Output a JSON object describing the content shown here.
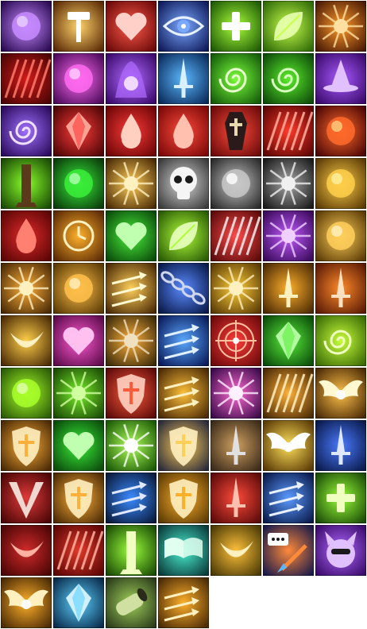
{
  "sheet": {
    "columns": 7,
    "icons": [
      {
        "name": "purple-orb-icon",
        "bg": "#2a0a52",
        "glow": "#c78bff",
        "fg": "#e9d2ff",
        "shape": "orb"
      },
      {
        "name": "hammer-burst-icon",
        "bg": "#5a2a05",
        "glow": "#ffd36b",
        "fg": "#ffffff",
        "shape": "hammer"
      },
      {
        "name": "heart-arrow-icon",
        "bg": "#6a0808",
        "glow": "#ff5a4a",
        "fg": "#ffd0c8",
        "shape": "heart"
      },
      {
        "name": "eye-icon",
        "bg": "#0f1a5a",
        "glow": "#7aa8ff",
        "fg": "#e6f0ff",
        "shape": "eye"
      },
      {
        "name": "green-cross-icon",
        "bg": "#1f5a05",
        "glow": "#a8ff3a",
        "fg": "#ffffff",
        "shape": "cross"
      },
      {
        "name": "leaf-icon",
        "bg": "#2f6a08",
        "glow": "#c8ff4a",
        "fg": "#e8ffb0",
        "shape": "leaf"
      },
      {
        "name": "fire-blade-icon",
        "bg": "#4a1a05",
        "glow": "#ff9a2a",
        "fg": "#ffe0a0",
        "shape": "burst"
      },
      {
        "name": "blood-rain-icon",
        "bg": "#4a0505",
        "glow": "#d01a1a",
        "fg": "#ff7a6a",
        "shape": "streaks"
      },
      {
        "name": "pink-sphere-icon",
        "bg": "#4a0a5a",
        "glow": "#ff6af0",
        "fg": "#ffd0ff",
        "shape": "orb"
      },
      {
        "name": "purple-aura-icon",
        "bg": "#3a0a6a",
        "glow": "#b06aff",
        "fg": "#f0d8ff",
        "shape": "aura"
      },
      {
        "name": "dagger-wings-icon",
        "bg": "#0a2a5a",
        "glow": "#5ab8ff",
        "fg": "#d8f0ff",
        "shape": "sword"
      },
      {
        "name": "green-swirl-icon",
        "bg": "#145a0a",
        "glow": "#7aff3a",
        "fg": "#e8ffd0",
        "shape": "swirl"
      },
      {
        "name": "green-vortex-icon",
        "bg": "#0e4a0a",
        "glow": "#5aef2a",
        "fg": "#d8ffc0",
        "shape": "swirl"
      },
      {
        "name": "wizard-hat-icon",
        "bg": "#3a0a6a",
        "glow": "#a85aff",
        "fg": "#e0c0ff",
        "shape": "hat"
      },
      {
        "name": "purple-galaxy-icon",
        "bg": "#2a0a5a",
        "glow": "#a070ff",
        "fg": "#f0e0ff",
        "shape": "swirl"
      },
      {
        "name": "crimson-crystal-icon",
        "bg": "#4a0505",
        "glow": "#ff3a3a",
        "fg": "#ffb0a0",
        "shape": "gem"
      },
      {
        "name": "blood-drop-orb-icon",
        "bg": "#6a0505",
        "glow": "#ff3a3a",
        "fg": "#ffd0c0",
        "shape": "drop"
      },
      {
        "name": "blood-drop-icon",
        "bg": "#7a0808",
        "glow": "#ff4a3a",
        "fg": "#ffc0b0",
        "shape": "drop"
      },
      {
        "name": "coffin-icon",
        "bg": "#6a0a0a",
        "glow": "#ff4a3a",
        "fg": "#e8d8b0",
        "shape": "coffin"
      },
      {
        "name": "red-slash-icon",
        "bg": "#5a0505",
        "glow": "#ff3a2a",
        "fg": "#ffb0a0",
        "shape": "streaks"
      },
      {
        "name": "fire-rune-icon",
        "bg": "#4a0505",
        "glow": "#ff6a2a",
        "fg": "#ffd080",
        "shape": "orb"
      },
      {
        "name": "green-pillar-icon",
        "bg": "#1a4a05",
        "glow": "#8aff2a",
        "fg": "#5a3a1a",
        "shape": "pillar"
      },
      {
        "name": "poison-cloud-icon",
        "bg": "#0a3a0a",
        "glow": "#3aef3a",
        "fg": "#b0ffb0",
        "shape": "orb"
      },
      {
        "name": "golden-leap-icon",
        "bg": "#4a2a05",
        "glow": "#ffcf5a",
        "fg": "#fff0c0",
        "shape": "burst"
      },
      {
        "name": "skull-icon",
        "bg": "#3a3a3a",
        "glow": "#d8d8d8",
        "fg": "#f5f5f5",
        "shape": "skull"
      },
      {
        "name": "silver-orb-icon",
        "bg": "#2a2a2a",
        "glow": "#c8c8c8",
        "fg": "#ffffff",
        "shape": "orb"
      },
      {
        "name": "steel-gauntlet-icon",
        "bg": "#1a1a1a",
        "glow": "#a8a8a8",
        "fg": "#f0f0f0",
        "shape": "burst"
      },
      {
        "name": "golden-egg-icon",
        "bg": "#5a3a05",
        "glow": "#ffcf4a",
        "fg": "#fff0a0",
        "shape": "orb"
      },
      {
        "name": "blood-drops-icon",
        "bg": "#5a0505",
        "glow": "#e02a2a",
        "fg": "#ff8070",
        "shape": "drop"
      },
      {
        "name": "golden-clock-icon",
        "bg": "#5a2a05",
        "glow": "#ffb02a",
        "fg": "#fff0c0",
        "shape": "clock"
      },
      {
        "name": "green-heart-icon",
        "bg": "#0a4a0a",
        "glow": "#4aef3a",
        "fg": "#c0ffb0",
        "shape": "heart"
      },
      {
        "name": "green-shield-icon",
        "bg": "#2a5a05",
        "glow": "#b0ff3a",
        "fg": "#e8ffc0",
        "shape": "leaf"
      },
      {
        "name": "red-claws-icon",
        "bg": "#5a0a0a",
        "glow": "#ff4a4a",
        "fg": "#f0f0f0",
        "shape": "streaks"
      },
      {
        "name": "purple-claw-icon",
        "bg": "#3a0a5a",
        "glow": "#c05aff",
        "fg": "#f0d0ff",
        "shape": "burst"
      },
      {
        "name": "golden-hand-icon",
        "bg": "#5a3a05",
        "glow": "#ffcf5a",
        "fg": "#fff0c0",
        "shape": "orb"
      },
      {
        "name": "golden-flame-hand-icon",
        "bg": "#4a2a05",
        "glow": "#ffb03a",
        "fg": "#fff0c0",
        "shape": "burst"
      },
      {
        "name": "golden-palm-icon",
        "bg": "#5a3a05",
        "glow": "#ffc04a",
        "fg": "#fff0c0",
        "shape": "orb"
      },
      {
        "name": "golden-arrows-icon",
        "bg": "#4a2a05",
        "glow": "#ffcf5a",
        "fg": "#fff8d0",
        "shape": "arrows"
      },
      {
        "name": "chains-icon",
        "bg": "#0a1a4a",
        "glow": "#5a8aff",
        "fg": "#d0d8f0",
        "shape": "chain"
      },
      {
        "name": "praying-hands-icon",
        "bg": "#5a3a05",
        "glow": "#ffcf3a",
        "fg": "#fff0c0",
        "shape": "burst"
      },
      {
        "name": "holy-sword-icon",
        "bg": "#4a2a05",
        "glow": "#ffb02a",
        "fg": "#fff0c0",
        "shape": "sword"
      },
      {
        "name": "crimson-dagger-icon",
        "bg": "#5a1a05",
        "glow": "#ff8a2a",
        "fg": "#ffe0c0",
        "shape": "sword"
      },
      {
        "name": "golden-crescent-icon",
        "bg": "#4a2a05",
        "glow": "#ffcf4a",
        "fg": "#fff0c0",
        "shape": "crescent"
      },
      {
        "name": "pink-hearts-icon",
        "bg": "#5a0a4a",
        "glow": "#ff5ad0",
        "fg": "#ffc0f0",
        "shape": "heart"
      },
      {
        "name": "golden-boot-icon",
        "bg": "#3a2a0a",
        "glow": "#ffb03a",
        "fg": "#f0e0c0",
        "shape": "burst"
      },
      {
        "name": "blue-spear-icon",
        "bg": "#0a1a5a",
        "glow": "#5aa8ff",
        "fg": "#e0f0ff",
        "shape": "arrows"
      },
      {
        "name": "red-target-icon",
        "bg": "#6a0a0a",
        "glow": "#ff3a3a",
        "fg": "#ffc0a0",
        "shape": "target"
      },
      {
        "name": "green-crystal-icon",
        "bg": "#0a4a0a",
        "glow": "#5aef3a",
        "fg": "#c0ffb0",
        "shape": "gem"
      },
      {
        "name": "lime-wind-icon",
        "bg": "#3a6a05",
        "glow": "#c8ff3a",
        "fg": "#f0ffc0",
        "shape": "swirl"
      },
      {
        "name": "green-egg-icon",
        "bg": "#2a5a05",
        "glow": "#a8ff2a",
        "fg": "#e0ffb0",
        "shape": "orb"
      },
      {
        "name": "thorns-icon",
        "bg": "#1a4a05",
        "glow": "#7aef2a",
        "fg": "#d0ffa0",
        "shape": "burst"
      },
      {
        "name": "crimson-crest-icon",
        "bg": "#5a0a0a",
        "glow": "#ff5a3a",
        "fg": "#ffd0c0",
        "shape": "shield"
      },
      {
        "name": "golden-lance-icon",
        "bg": "#4a2a05",
        "glow": "#ffc03a",
        "fg": "#fff0c0",
        "shape": "arrows"
      },
      {
        "name": "purple-fist-icon",
        "bg": "#3a0a4a",
        "glow": "#ff6ad0",
        "fg": "#fff0ff",
        "shape": "burst"
      },
      {
        "name": "golden-rays-icon",
        "bg": "#4a2a05",
        "glow": "#ffb03a",
        "fg": "#fff0c0",
        "shape": "streaks"
      },
      {
        "name": "winged-emblem-icon",
        "bg": "#4a2a05",
        "glow": "#ffc04a",
        "fg": "#fff8d0",
        "shape": "wings"
      },
      {
        "name": "cross-shield-icon",
        "bg": "#4a2a05",
        "glow": "#ffb03a",
        "fg": "#fff0c0",
        "shape": "shield"
      },
      {
        "name": "emerald-heart-icon",
        "bg": "#0a4a0a",
        "glow": "#3aef3a",
        "fg": "#c0ffb0",
        "shape": "heart"
      },
      {
        "name": "green-flash-icon",
        "bg": "#1a5a05",
        "glow": "#b0ff5a",
        "fg": "#ffffff",
        "shape": "burst"
      },
      {
        "name": "holy-shield-icon",
        "bg": "#2a2a3a",
        "glow": "#ffcf5a",
        "fg": "#fff0c0",
        "shape": "shield"
      },
      {
        "name": "sword-shield-icon",
        "bg": "#3a2a1a",
        "glow": "#d0a060",
        "fg": "#e0e0e0",
        "shape": "sword"
      },
      {
        "name": "radiant-wings-icon",
        "bg": "#5a3a05",
        "glow": "#ffe05a",
        "fg": "#ffffff",
        "shape": "wings"
      },
      {
        "name": "azure-blade-icon",
        "bg": "#0a1a4a",
        "glow": "#4a7aff",
        "fg": "#e0e8ff",
        "shape": "sword"
      },
      {
        "name": "crimson-v-icon",
        "bg": "#4a0505",
        "glow": "#e03a3a",
        "fg": "#f0d8d0",
        "shape": "vmark"
      },
      {
        "name": "golden-impact-icon",
        "bg": "#4a2a05",
        "glow": "#ffb03a",
        "fg": "#fff0c0",
        "shape": "shield"
      },
      {
        "name": "twin-blades-icon",
        "bg": "#0a1a3a",
        "glow": "#3a8aff",
        "fg": "#e0e8ff",
        "shape": "arrows"
      },
      {
        "name": "crusader-shield-icon",
        "bg": "#5a3a05",
        "glow": "#ffb02a",
        "fg": "#fff0c0",
        "shape": "shield"
      },
      {
        "name": "blood-blade-icon",
        "bg": "#5a0a0a",
        "glow": "#ff4a3a",
        "fg": "#ffc0b0",
        "shape": "sword"
      },
      {
        "name": "triple-spears-icon",
        "bg": "#0a1a4a",
        "glow": "#5a9aff",
        "fg": "#e8f0ff",
        "shape": "arrows"
      },
      {
        "name": "green-blessing-icon",
        "bg": "#1a4a05",
        "glow": "#9aff3a",
        "fg": "#f0ffc0",
        "shape": "cross"
      },
      {
        "name": "red-scythe-icon",
        "bg": "#4a0505",
        "glow": "#d02a2a",
        "fg": "#ffb0a0",
        "shape": "crescent"
      },
      {
        "name": "crimson-feather-icon",
        "bg": "#5a0505",
        "glow": "#e03a2a",
        "fg": "#ffb0a0",
        "shape": "streaks"
      },
      {
        "name": "green-obelisk-icon",
        "bg": "#1a4a05",
        "glow": "#9aff3a",
        "fg": "#f0ffc0",
        "shape": "pillar"
      },
      {
        "name": "spellbook-icon",
        "bg": "#0a3a3a",
        "glow": "#4aefd0",
        "fg": "#e0fff0",
        "shape": "book"
      },
      {
        "name": "golden-arc-icon",
        "bg": "#4a3a05",
        "glow": "#ffc03a",
        "fg": "#fff0c0",
        "shape": "crescent"
      },
      {
        "name": "chat-dagger-icon",
        "bg": "#1a1a4a",
        "glow": "#ff8a3a",
        "fg": "#ffffff",
        "shape": "chat"
      },
      {
        "name": "purple-imp-icon",
        "bg": "#3a0a6a",
        "glow": "#b06aff",
        "fg": "#e0c0ff",
        "shape": "imp"
      },
      {
        "name": "phoenix-wings-icon",
        "bg": "#4a2a05",
        "glow": "#ffb02a",
        "fg": "#fff0c0",
        "shape": "wings"
      },
      {
        "name": "ice-crystal-icon",
        "bg": "#0a2a4a",
        "glow": "#5ad0ff",
        "fg": "#e0f8ff",
        "shape": "gem"
      },
      {
        "name": "green-cannon-icon",
        "bg": "#2a3a1a",
        "glow": "#a0d05a",
        "fg": "#d0e0a0",
        "shape": "cannon"
      },
      {
        "name": "flaming-blade-icon",
        "bg": "#4a2a05",
        "glow": "#ffb02a",
        "fg": "#fff0c0",
        "shape": "arrows"
      }
    ]
  }
}
